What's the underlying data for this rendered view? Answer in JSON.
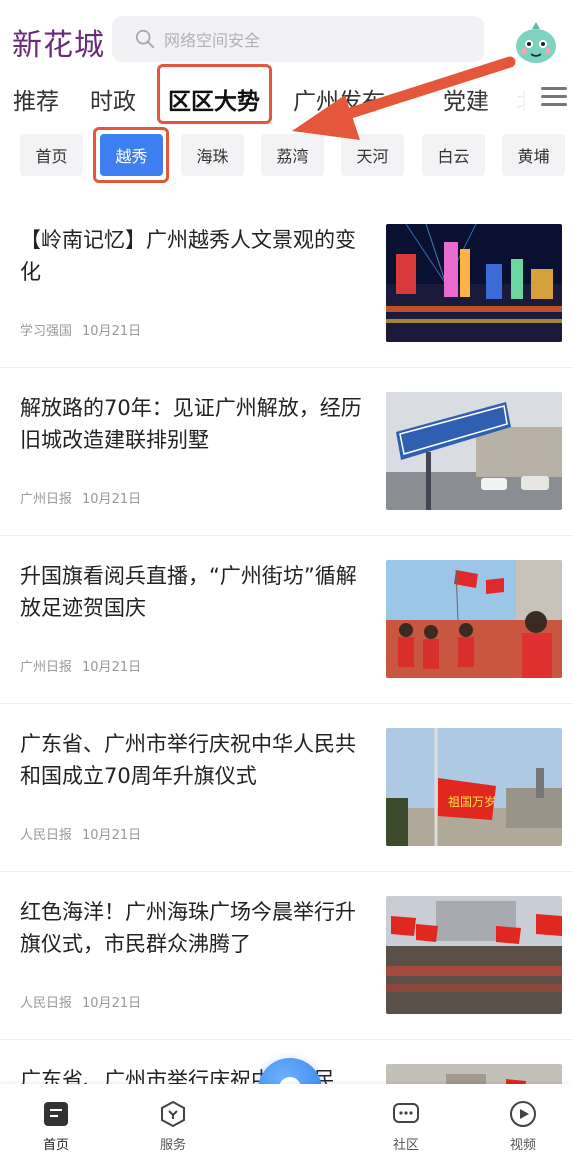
{
  "header": {
    "logo": "新花城",
    "search_placeholder": "网络空间安全",
    "search_icon": "search-icon",
    "avatar_icon": "cartoon-avatar-icon"
  },
  "channel_tabs": [
    {
      "label": "推荐",
      "active": false
    },
    {
      "label": "时政",
      "active": false
    },
    {
      "label": "区区大势",
      "active": true
    },
    {
      "label": "广州发布",
      "active": false
    },
    {
      "label": "党建",
      "active": false
    },
    {
      "label": "北",
      "active": false
    }
  ],
  "menu_icon": "hamburger-menu-icon",
  "districts": [
    {
      "label": "首页",
      "active": false
    },
    {
      "label": "越秀",
      "active": true
    },
    {
      "label": "海珠",
      "active": false
    },
    {
      "label": "荔湾",
      "active": false
    },
    {
      "label": "天河",
      "active": false
    },
    {
      "label": "白云",
      "active": false
    },
    {
      "label": "黄埔",
      "active": false
    }
  ],
  "annotation_color": "#e5573a",
  "accent_color": "#3d7ef0",
  "news": [
    {
      "title": "【岭南记忆】广州越秀人文景观的变化",
      "source": "学习强国",
      "date": "10月21日",
      "image": "night-city-skyline"
    },
    {
      "title": "解放路的70年：见证广州解放，经历旧城改造建联排别墅",
      "source": "广州日报",
      "date": "10月21日",
      "image": "street-sign"
    },
    {
      "title": "升国旗看阅兵直播，“广州街坊”循解放足迹贺国庆",
      "source": "广州日报",
      "date": "10月21日",
      "image": "crowd-with-flags"
    },
    {
      "title": "广东省、广州市举行庆祝中华人民共和国成立70周年升旗仪式",
      "source": "人民日报",
      "date": "10月21日",
      "image": "flag-raising",
      "image_caption": "祖国万岁"
    },
    {
      "title": "红色海洋！广州海珠广场今晨举行升旗仪式，市民群众沸腾了",
      "source": "人民日报",
      "date": "10月21日",
      "image": "plaza-crowd"
    },
    {
      "title": "广东省、广州市举行庆祝中华人民",
      "source": "",
      "date": "",
      "image": "partial"
    }
  ],
  "bottom_nav": [
    {
      "label": "首页",
      "icon": "home-icon",
      "active": true
    },
    {
      "label": "服务",
      "icon": "service-icon",
      "active": false
    },
    {
      "label": "社区",
      "icon": "community-icon",
      "active": false
    },
    {
      "label": "视频",
      "icon": "video-play-icon",
      "active": false
    }
  ],
  "center_button_icon": "voice-assistant-icon"
}
